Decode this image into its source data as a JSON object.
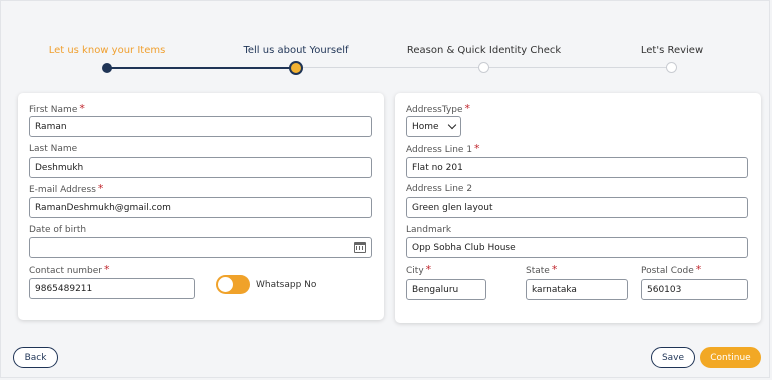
{
  "stepper": {
    "steps": [
      {
        "label": "Let us know your Items",
        "state": "done"
      },
      {
        "label": "Tell us about Yourself",
        "state": "active"
      },
      {
        "label": "Reason & Quick Identity Check",
        "state": "todo"
      },
      {
        "label": "Let's Review",
        "state": "todo"
      }
    ]
  },
  "personal": {
    "first_name": {
      "label": "First Name",
      "value": "Raman"
    },
    "last_name": {
      "label": "Last Name",
      "value": "Deshmukh"
    },
    "email": {
      "label": "E-mail Address",
      "value": "RamanDeshmukh@gmail.com"
    },
    "dob": {
      "label": "Date of birth",
      "value": ""
    },
    "contact": {
      "label": "Contact number",
      "value": "9865489211"
    },
    "whatsapp": {
      "label": "Whatsapp No",
      "on": true
    }
  },
  "address": {
    "type": {
      "label": "AddressType",
      "value": "Home"
    },
    "line1": {
      "label": "Address Line 1",
      "value": "Flat no 201"
    },
    "line2": {
      "label": "Address Line 2",
      "value": "Green glen layout"
    },
    "landmark": {
      "label": "Landmark",
      "value": "Opp Sobha Club House"
    },
    "city": {
      "label": "City",
      "value": "Bengaluru"
    },
    "state": {
      "label": "State",
      "value": "karnataka"
    },
    "postal": {
      "label": "Postal Code",
      "value": "560103"
    }
  },
  "actions": {
    "back": "Back",
    "save": "Save",
    "continue": "Continue"
  },
  "colors": {
    "accent": "#f2a825",
    "navy": "#1f3456",
    "required": "#c0262d"
  }
}
